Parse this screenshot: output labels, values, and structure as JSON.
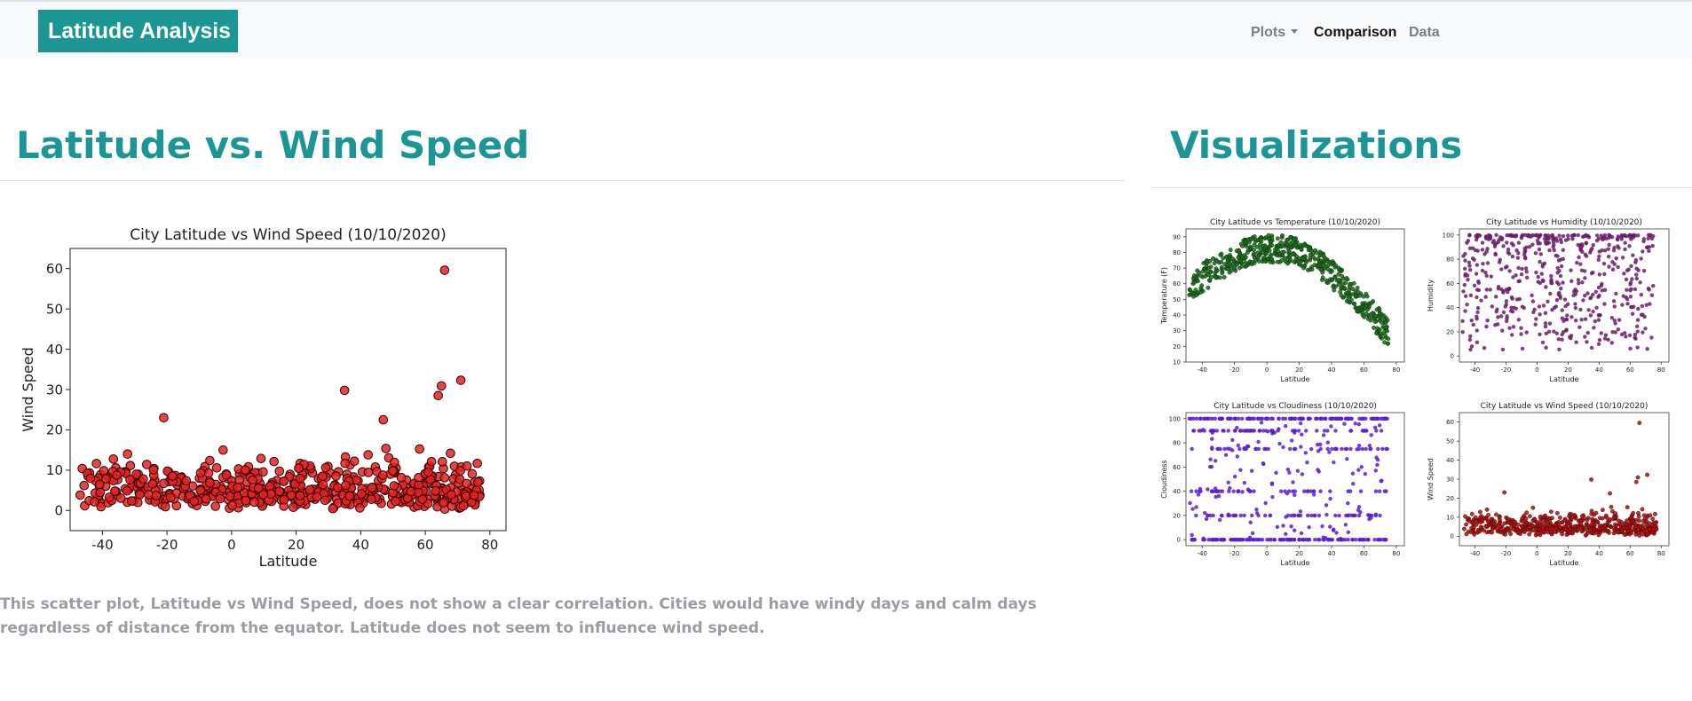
{
  "navbar": {
    "brand": "Latitude Analysis",
    "items": [
      {
        "label": "Plots",
        "dropdown": true,
        "active": false
      },
      {
        "label": "Comparison",
        "dropdown": false,
        "active": true
      },
      {
        "label": "Data",
        "dropdown": false,
        "active": false
      }
    ]
  },
  "main": {
    "heading": "Latitude vs. Wind Speed",
    "description": "This scatter plot, Latitude vs Wind Speed, does not show a clear correlation. Cities would have windy days and calm days regardless of distance from the equator. Latitude does not seem to influence wind speed."
  },
  "sidebar": {
    "heading": "Visualizations"
  },
  "colors": {
    "accent": "#1b9695",
    "temperature": "#1a6b1a",
    "humidity": "#6a1f6a",
    "cloudiness": "#5a1fd0",
    "windspeed": "#a81010"
  },
  "chart_data": [
    {
      "id": "main-wind",
      "type": "scatter",
      "title": "City Latitude vs Wind Speed (10/10/2020)",
      "xlabel": "Latitude",
      "ylabel": "Wind Speed",
      "xlim": [
        -50,
        85
      ],
      "ylim": [
        -5,
        65
      ],
      "xticks": [
        -40,
        -20,
        0,
        20,
        40,
        60,
        80
      ],
      "yticks": [
        0,
        10,
        20,
        30,
        40,
        50,
        60
      ],
      "marker_color": "#e02424",
      "outliers": [
        [
          66,
          59.6
        ],
        [
          35,
          29.8
        ],
        [
          65,
          30.9
        ],
        [
          71,
          32.3
        ],
        [
          64,
          28.5
        ],
        [
          -21,
          23.0
        ],
        [
          47,
          22.5
        ]
      ]
    },
    {
      "id": "thumb-temp",
      "type": "scatter",
      "title": "City Latitude vs Temperature (10/10/2020)",
      "xlabel": "Latitude",
      "ylabel": "Temperature (F)",
      "xlim": [
        -50,
        85
      ],
      "ylim": [
        10,
        95
      ],
      "xticks": [
        -40,
        -20,
        0,
        20,
        40,
        60,
        80
      ],
      "yticks": [
        10,
        20,
        30,
        40,
        50,
        60,
        70,
        80,
        90
      ],
      "marker_color": "#1a6b1a",
      "outliers": []
    },
    {
      "id": "thumb-humidity",
      "type": "scatter",
      "title": "City Latitude vs Humidity (10/10/2020)",
      "xlabel": "Latitude",
      "ylabel": "Humidity",
      "xlim": [
        -50,
        85
      ],
      "ylim": [
        -5,
        105
      ],
      "xticks": [
        -40,
        -20,
        0,
        20,
        40,
        60,
        80
      ],
      "yticks": [
        0,
        20,
        40,
        60,
        80,
        100
      ],
      "marker_color": "#6a1f6a",
      "outliers": []
    },
    {
      "id": "thumb-cloud",
      "type": "scatter",
      "title": "City Latitude vs Cloudiness (10/10/2020)",
      "xlabel": "Latitude",
      "ylabel": "Cloudiness",
      "xlim": [
        -50,
        85
      ],
      "ylim": [
        -5,
        105
      ],
      "xticks": [
        -40,
        -20,
        0,
        20,
        40,
        60,
        80
      ],
      "yticks": [
        0,
        20,
        40,
        60,
        80,
        100
      ],
      "marker_color": "#5a1fd0",
      "outliers": []
    },
    {
      "id": "thumb-wind",
      "type": "scatter",
      "title": "City Latitude vs Wind Speed (10/10/2020)",
      "xlabel": "Latitude",
      "ylabel": "Wind Speed",
      "xlim": [
        -50,
        85
      ],
      "ylim": [
        -5,
        65
      ],
      "xticks": [
        -40,
        -20,
        0,
        20,
        40,
        60,
        80
      ],
      "yticks": [
        0,
        10,
        20,
        30,
        40,
        50,
        60
      ],
      "marker_color": "#a81010",
      "outliers": [
        [
          66,
          59.6
        ],
        [
          35,
          29.8
        ],
        [
          65,
          30.9
        ],
        [
          71,
          32.3
        ],
        [
          64,
          28.5
        ],
        [
          -21,
          23.0
        ],
        [
          47,
          22.5
        ]
      ]
    }
  ]
}
